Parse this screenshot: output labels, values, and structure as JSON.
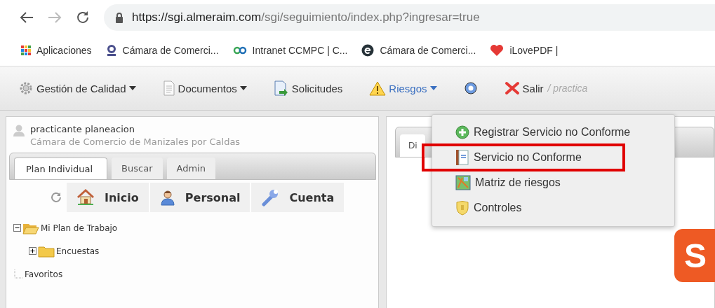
{
  "browser": {
    "url_host": "https://sgi.almeraim.com",
    "url_path": "/sgi/seguimiento/index.php?ingresar=true",
    "bookmarks": [
      {
        "label": "Aplicaciones",
        "kind": "apps"
      },
      {
        "label": "Cámara de Comerci...",
        "kind": "badge"
      },
      {
        "label": "Intranet CCMPC | C...",
        "kind": "loop"
      },
      {
        "label": "Cámara de Comerci...",
        "kind": "circle"
      },
      {
        "label": "iLovePDF |",
        "kind": "heart"
      }
    ]
  },
  "toolbar": {
    "items": [
      {
        "label": "Gestión de Calidad",
        "kind": "gear",
        "caret": true,
        "expanded": false
      },
      {
        "label": "Documentos",
        "kind": "page",
        "caret": true,
        "expanded": false
      },
      {
        "label": "Solicitudes",
        "kind": "request",
        "caret": false,
        "expanded": false
      },
      {
        "label": "Riesgos",
        "kind": "warning",
        "caret": true,
        "expanded": true
      },
      {
        "kind": "help",
        "caret": false,
        "expanded": false
      },
      {
        "label": "Salir",
        "kind": "close",
        "caret": false,
        "expanded": false
      }
    ],
    "user_hint": "/ practica"
  },
  "dropdown": {
    "items": [
      {
        "label": "Registrar Servicio no Conforme",
        "kind": "add",
        "annotated": false
      },
      {
        "label": "Servicio no Conforme",
        "kind": "document",
        "annotated": true
      },
      {
        "label": "Matriz de riesgos",
        "kind": "map",
        "annotated": false
      },
      {
        "label": "Controles",
        "kind": "shield",
        "annotated": false
      }
    ]
  },
  "left_panel": {
    "user_name": "practicante planeacion",
    "organization": "Cámara de Comercio de Manizales por Caldas",
    "tabs": [
      {
        "label": "Plan Individual",
        "selected": true
      },
      {
        "label": "Buscar",
        "selected": false
      },
      {
        "label": "Admin",
        "selected": false
      }
    ],
    "buttons": [
      {
        "label": "Inicio",
        "kind": "house"
      },
      {
        "label": "Personal",
        "kind": "person"
      },
      {
        "label": "Cuenta",
        "kind": "wrench"
      }
    ],
    "tree": [
      {
        "label": "Mi Plan de Trabajo",
        "kind": "folder",
        "expanded": true,
        "children": [
          {
            "label": "Encuestas",
            "kind": "folder",
            "expanded": false
          }
        ]
      },
      {
        "label": "Favoritos",
        "kind": "leaf"
      }
    ]
  },
  "right_panel": {
    "tab": "Di",
    "logo_letter": "S"
  }
}
